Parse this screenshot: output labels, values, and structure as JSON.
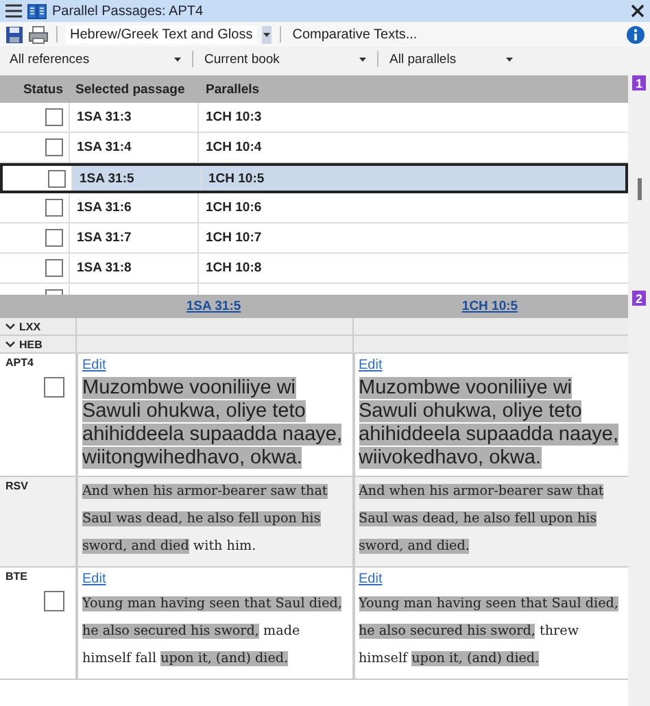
{
  "window": {
    "title": "Parallel Passages: APT4"
  },
  "toolbar": {
    "view_dropdown": "Hebrew/Greek Text and Gloss",
    "comparative_button": "Comparative Texts..."
  },
  "filters": [
    {
      "label": "All references"
    },
    {
      "label": "Current book"
    },
    {
      "label": "All parallels"
    }
  ],
  "markers": [
    "1",
    "2"
  ],
  "grid": {
    "columns": [
      "Status",
      "Selected passage",
      "Parallels"
    ],
    "rows": [
      {
        "passage": "1SA 31:3",
        "parallel": "1CH 10:3",
        "checked": false,
        "selected": false
      },
      {
        "passage": "1SA 31:4",
        "parallel": "1CH 10:4",
        "checked": false,
        "selected": false
      },
      {
        "passage": "1SA 31:5",
        "parallel": "1CH 10:5",
        "checked": false,
        "selected": true
      },
      {
        "passage": "1SA 31:6",
        "parallel": "1CH 10:6",
        "checked": false,
        "selected": false
      },
      {
        "passage": "1SA 31:7",
        "parallel": "1CH 10:7",
        "checked": false,
        "selected": false
      },
      {
        "passage": "1SA 31:8",
        "parallel": "1CH 10:8",
        "checked": false,
        "selected": false
      }
    ]
  },
  "comparison": {
    "headers": [
      "1SA 31:5",
      "1CH 10:5"
    ],
    "groups": [
      {
        "label": "LXX",
        "expanded": true
      },
      {
        "label": "HEB",
        "expanded": true
      }
    ],
    "texts": [
      {
        "label": "APT4",
        "kind": "vernacular",
        "checked": false,
        "cells": [
          {
            "edit": "Edit",
            "segments": [
              {
                "text": "Muzombwe vooniliiye wi Sawuli ohukwa, oliye teto ahihiddeela supaadda naaye, wiitongwihedhavo, okwa.",
                "highlighted": true
              }
            ]
          },
          {
            "edit": "Edit",
            "segments": [
              {
                "text": "Muzombwe vooniliiye wi Sawuli ohukwa, oliye teto ahihiddeela supaadda naaye, wiivokedhavo, okwa.",
                "highlighted": true
              }
            ]
          }
        ]
      },
      {
        "label": "RSV",
        "kind": "reference",
        "cells": [
          {
            "segments": [
              {
                "text": "And when his armor-bearer saw that Saul was dead, he also fell upon his sword, and died",
                "highlighted": true
              },
              {
                "text": " with him.",
                "highlighted": false
              }
            ]
          },
          {
            "segments": [
              {
                "text": "And when his armor-bearer saw that Saul was dead, he also fell upon his sword, and died.",
                "highlighted": true
              }
            ]
          }
        ]
      },
      {
        "label": "BTE",
        "kind": "back_translation",
        "checked": false,
        "cells": [
          {
            "edit": "Edit",
            "segments": [
              {
                "text": "Young man having seen that Saul died, he also secured his sword,",
                "highlighted": true
              },
              {
                "text": " made himself fall ",
                "highlighted": false
              },
              {
                "text": "upon it, (and) died.",
                "highlighted": true
              }
            ]
          },
          {
            "edit": "Edit",
            "segments": [
              {
                "text": "Young man having seen that Saul died, he also secured his sword,",
                "highlighted": true
              },
              {
                "text": " threw himself ",
                "highlighted": false
              },
              {
                "text": "upon it, (and) died.",
                "highlighted": true
              }
            ]
          }
        ]
      }
    ]
  }
}
